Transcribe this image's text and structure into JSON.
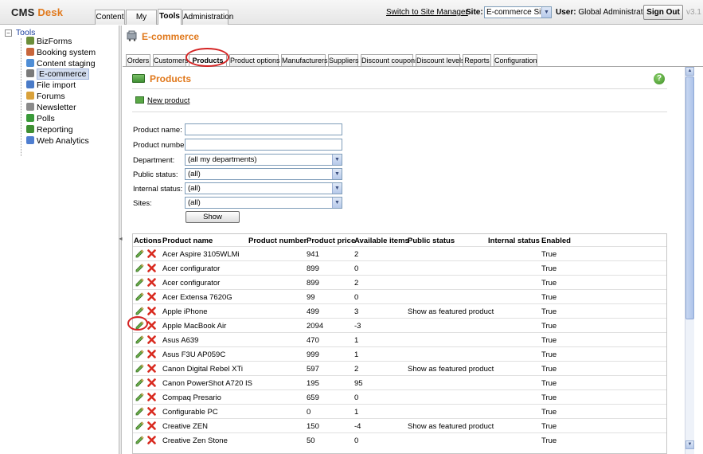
{
  "header": {
    "logo_cms": "CMS",
    "logo_desk": "Desk",
    "tabs": [
      "Content",
      "My Desk",
      "Tools",
      "Administration"
    ],
    "active_tab": "Tools",
    "switch_link": "Switch to Site Manager",
    "site_label": "Site:",
    "site_value": "E-commerce Site",
    "user_label": "User:",
    "user_value": "Global Administrator",
    "signout": "Sign Out",
    "version": "v3.1"
  },
  "tree": {
    "root": "Tools",
    "items": [
      {
        "label": "BizForms",
        "icon": "bizforms-icon",
        "color": "#6b8e3a"
      },
      {
        "label": "Booking system",
        "icon": "booking-icon",
        "color": "#c8663c"
      },
      {
        "label": "Content staging",
        "icon": "staging-icon",
        "color": "#4f8ed6"
      },
      {
        "label": "E-commerce",
        "icon": "ecommerce-icon",
        "color": "#7b7b7b"
      },
      {
        "label": "File import",
        "icon": "file-import-icon",
        "color": "#4a7bc8"
      },
      {
        "label": "Forums",
        "icon": "forums-icon",
        "color": "#d9a13a"
      },
      {
        "label": "Newsletter",
        "icon": "newsletter-icon",
        "color": "#8a8a8a"
      },
      {
        "label": "Polls",
        "icon": "polls-icon",
        "color": "#3a9a3a"
      },
      {
        "label": "Reporting",
        "icon": "reporting-icon",
        "color": "#3f8f33"
      },
      {
        "label": "Web Analytics",
        "icon": "web-analytics-icon",
        "color": "#4f7ed0"
      }
    ],
    "active_item": "E-commerce"
  },
  "module": {
    "title": "E-commerce",
    "tabs": [
      "Orders",
      "Customers",
      "Products",
      "Product options",
      "Manufacturers",
      "Suppliers",
      "Discount coupons",
      "Discount levels",
      "Reports",
      "Configuration"
    ],
    "active_tab": "Products"
  },
  "page": {
    "title": "Products",
    "new_product": "New product"
  },
  "filter": {
    "product_name_label": "Product name:",
    "product_name_value": "",
    "product_number_label": "Product number:",
    "product_number_value": "",
    "department_label": "Department:",
    "department_value": "(all my departments)",
    "public_status_label": "Public status:",
    "public_status_value": "(all)",
    "internal_status_label": "Internal status:",
    "internal_status_value": "(all)",
    "sites_label": "Sites:",
    "sites_value": "(all)",
    "show_button": "Show"
  },
  "grid": {
    "columns": [
      "Actions",
      "Product name",
      "Product number",
      "Product price",
      "Available items",
      "Public status",
      "Internal status",
      "Enabled"
    ],
    "rows": [
      {
        "name": "Acer Aspire 3105WLMi",
        "number": "",
        "price": "941",
        "available": "2",
        "public_status": "",
        "internal_status": "",
        "enabled": "True"
      },
      {
        "name": "Acer configurator",
        "number": "",
        "price": "899",
        "available": "0",
        "public_status": "",
        "internal_status": "",
        "enabled": "True"
      },
      {
        "name": "Acer configurator",
        "number": "",
        "price": "899",
        "available": "2",
        "public_status": "",
        "internal_status": "",
        "enabled": "True"
      },
      {
        "name": "Acer Extensa 7620G",
        "number": "",
        "price": "99",
        "available": "0",
        "public_status": "",
        "internal_status": "",
        "enabled": "True"
      },
      {
        "name": "Apple iPhone",
        "number": "",
        "price": "499",
        "available": "3",
        "public_status": "Show as featured product",
        "internal_status": "",
        "enabled": "True"
      },
      {
        "name": "Apple MacBook Air",
        "number": "",
        "price": "2094",
        "available": "-3",
        "public_status": "",
        "internal_status": "",
        "enabled": "True"
      },
      {
        "name": "Asus A639",
        "number": "",
        "price": "470",
        "available": "1",
        "public_status": "",
        "internal_status": "",
        "enabled": "True"
      },
      {
        "name": "Asus F3U AP059C",
        "number": "",
        "price": "999",
        "available": "1",
        "public_status": "",
        "internal_status": "",
        "enabled": "True"
      },
      {
        "name": "Canon Digital Rebel XTi",
        "number": "",
        "price": "597",
        "available": "2",
        "public_status": "Show as featured product",
        "internal_status": "",
        "enabled": "True"
      },
      {
        "name": "Canon PowerShot A720 IS",
        "number": "",
        "price": "195",
        "available": "95",
        "public_status": "",
        "internal_status": "",
        "enabled": "True"
      },
      {
        "name": "Compaq Presario",
        "number": "",
        "price": "659",
        "available": "0",
        "public_status": "",
        "internal_status": "",
        "enabled": "True"
      },
      {
        "name": "Configurable PC",
        "number": "",
        "price": "0",
        "available": "1",
        "public_status": "",
        "internal_status": "",
        "enabled": "True"
      },
      {
        "name": "Creative ZEN",
        "number": "",
        "price": "150",
        "available": "-4",
        "public_status": "Show as featured product",
        "internal_status": "",
        "enabled": "True"
      },
      {
        "name": "Creative Zen Stone",
        "number": "",
        "price": "50",
        "available": "0",
        "public_status": "",
        "internal_status": "",
        "enabled": "True"
      }
    ]
  }
}
